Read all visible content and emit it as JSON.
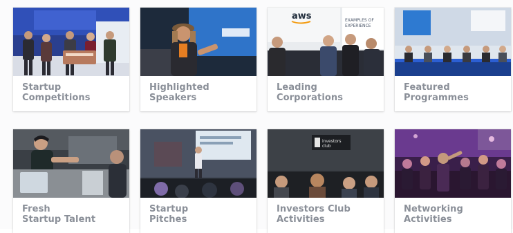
{
  "cards": [
    {
      "line1": "Startup",
      "line2": "Competitions",
      "photo": "startup-competitions-photo"
    },
    {
      "line1": "Highlighted",
      "line2": "Speakers",
      "photo": "highlighted-speakers-photo"
    },
    {
      "line1": "Leading",
      "line2": "Corporations",
      "photo": "leading-corporations-photo",
      "sign1": "aws",
      "sign2": "EXAMPLES OF",
      "sign3": "EXPERIENCE"
    },
    {
      "line1": "Featured",
      "line2": "Programmes",
      "photo": "featured-programmes-photo"
    },
    {
      "line1": "Fresh",
      "line2": "Startup Talent",
      "photo": "fresh-startup-talent-photo"
    },
    {
      "line1": "Startup",
      "line2": "Pitches",
      "photo": "startup-pitches-photo"
    },
    {
      "line1": "Investors Club",
      "line2": "Activities",
      "photo": "investors-club-photo",
      "sign1": "investors",
      "sign2": "club"
    },
    {
      "line1": "Networking",
      "line2": "Activities",
      "photo": "networking-photo"
    }
  ],
  "colors": {
    "caption": "#8a8f98",
    "card_bg": "#ffffff"
  }
}
